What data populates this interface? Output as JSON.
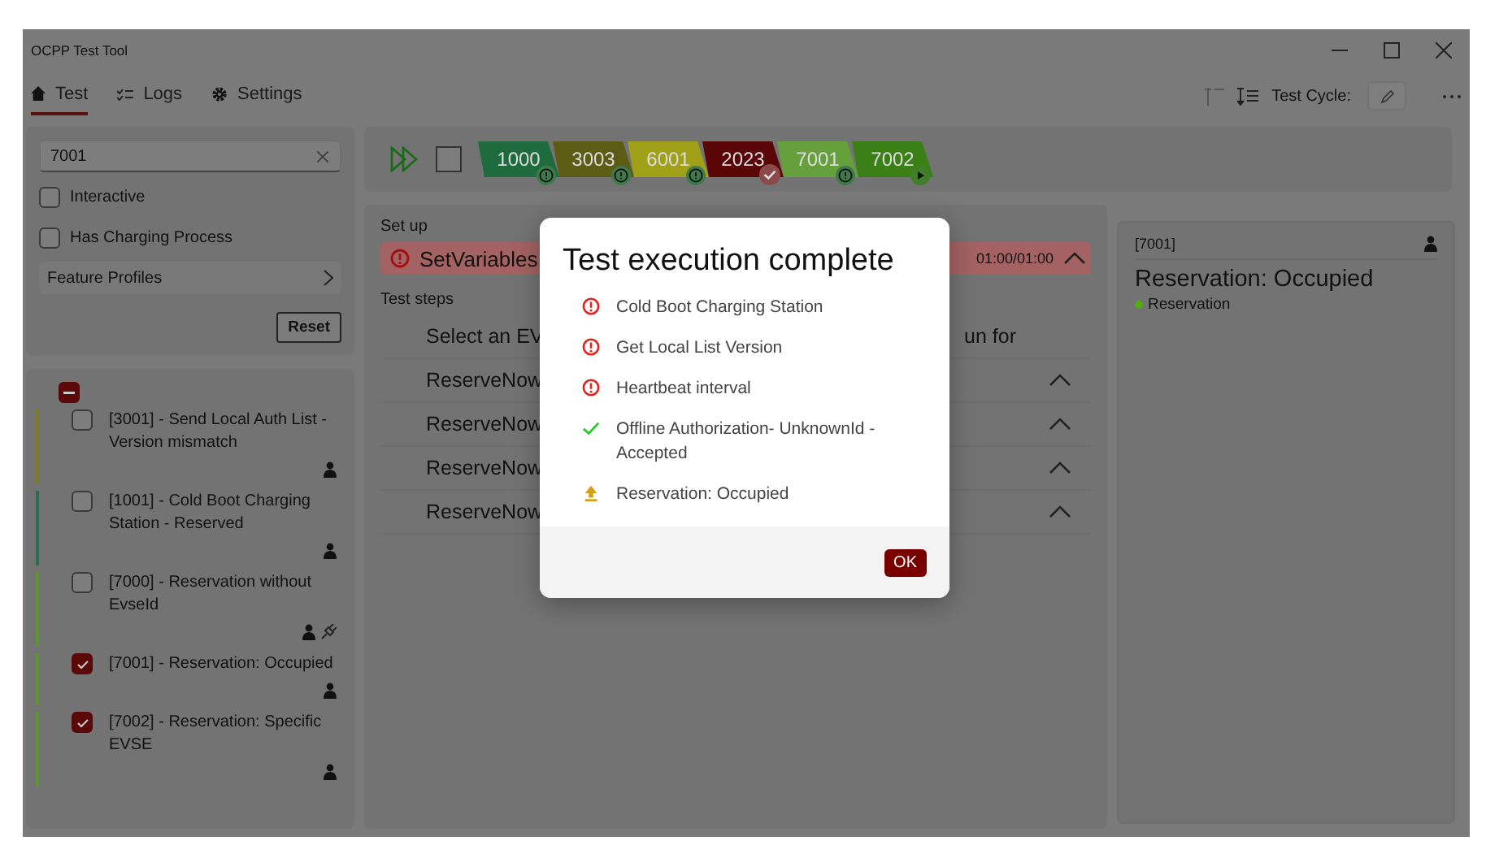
{
  "window": {
    "title": "OCPP Test Tool"
  },
  "tabs": [
    {
      "label": "Test",
      "selected": true
    },
    {
      "label": "Logs",
      "selected": false
    },
    {
      "label": "Settings",
      "selected": false
    }
  ],
  "toolbar": {
    "test_cycle_label": "Test Cycle:"
  },
  "filters": {
    "search": "7001",
    "options": [
      {
        "label": "Interactive",
        "checked": false
      },
      {
        "label": "Has Charging Process",
        "checked": false
      }
    ],
    "feature_profiles": "Feature Profiles",
    "reset": "Reset"
  },
  "test_list": {
    "select_all": {
      "indeterminate": true
    },
    "items": [
      {
        "label": "[3001] - Send Local Auth List - Version mismatch",
        "checked": false,
        "color": "#7a7a22",
        "kind": "plain"
      },
      {
        "label": "[1001] - Cold Boot Charging Station - Reserved",
        "checked": false,
        "color": "#2f6a50",
        "kind": "plain"
      },
      {
        "label": "[7000] - Reservation without EvseId",
        "checked": false,
        "color": "#5c9530",
        "kind": "with-plug"
      },
      {
        "label": "[7001] - Reservation: Occupied",
        "checked": true,
        "color": "#5c9530",
        "kind": "plain"
      },
      {
        "label": "[7002] - Reservation: Specific EVSE",
        "checked": true,
        "color": "#5c9530",
        "kind": "plain"
      }
    ]
  },
  "run_bar": {
    "all_selected": false,
    "badges": [
      {
        "label": "1000",
        "color": "#1e6b3e",
        "kind": "warning"
      },
      {
        "label": "3003",
        "color": "#5c5c14",
        "kind": "warning"
      },
      {
        "label": "6001",
        "color": "#a0a019",
        "kind": "warning"
      },
      {
        "label": "2023",
        "color": "#5a0606",
        "kind": "passed"
      },
      {
        "label": "7001",
        "color": "#66a03c",
        "kind": "warning"
      },
      {
        "label": "7002",
        "color": "#3b8016",
        "kind": "running"
      }
    ]
  },
  "setup": {
    "heading": "Set up",
    "step": {
      "label": "SetVariables",
      "time": "01:00/01:00",
      "kind": "error"
    }
  },
  "test_steps": {
    "heading": "Test steps",
    "rows": [
      {
        "label": "Select an EV",
        "trailing": "un for",
        "expandable": false
      },
      {
        "label": "ReserveNow",
        "expandable": true
      },
      {
        "label": "ReserveNow",
        "expandable": true
      },
      {
        "label": "ReserveNow",
        "expandable": true
      },
      {
        "label": "ReserveNow",
        "expandable": true
      }
    ]
  },
  "details": {
    "id": "[7001]",
    "title": "Reservation: Occupied",
    "tags": [
      {
        "label": "Reservation",
        "color": "#55aa11"
      }
    ]
  },
  "dialog": {
    "title": "Test execution complete",
    "results": [
      {
        "label": "Cold Boot Charging Station",
        "kind": "error"
      },
      {
        "label": "Get Local List Version",
        "kind": "error"
      },
      {
        "label": "Heartbeat interval",
        "kind": "error"
      },
      {
        "label": "Offline Authorization- UnknownId - Accepted",
        "kind": "success"
      },
      {
        "label": "Reservation: Occupied",
        "kind": "pending"
      }
    ],
    "button": "OK"
  }
}
